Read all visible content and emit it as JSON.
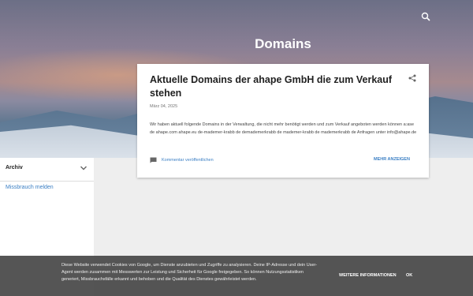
{
  "header": {
    "blog_title": "Domains",
    "search_icon": "search-icon"
  },
  "sidebar": {
    "archive_label": "Archiv",
    "archive_icon": "chevron-down-icon",
    "report_link": "Missbrauch melden"
  },
  "post": {
    "title": "Aktuelle Domains der ahape GmbH die zum Verkauf stehen",
    "date": "März 04, 2025",
    "body": "Wir haben aktuell folgende Domains in der Verwaltung, die nicht mehr benötigt werden und zum Verkauf angeboten werden können a:ase de ahape.com ahape.eu de-mademer-krabb de demademerkrabb de mademer-krabb de mademerkrabb de Anfragen unter  info@ahape.de",
    "comment_label": "Kommentar veröffentlichen",
    "more_label": "MEHR ANZEIGEN",
    "share_icon": "share-icon",
    "comment_icon": "comment-icon"
  },
  "cookie": {
    "text": "Diese Website verwendet Cookies von Google, um Dienste anzubieten und Zugriffe zu analysieren. Deine IP-Adresse und dein User-Agent werden zusammen mit Messwerten zur Leistung und Sicherheit für Google freigegeben. So können Nutzungsstatistiken generiert, Missbrauchsfälle erkannt und behoben und die Qualität des Dienstes gewährleistet werden.",
    "info_label": "WEITERE INFORMATIONEN",
    "ok_label": "OK"
  },
  "colors": {
    "accent": "#3b7fc4",
    "cookie_bg": "#464646"
  }
}
